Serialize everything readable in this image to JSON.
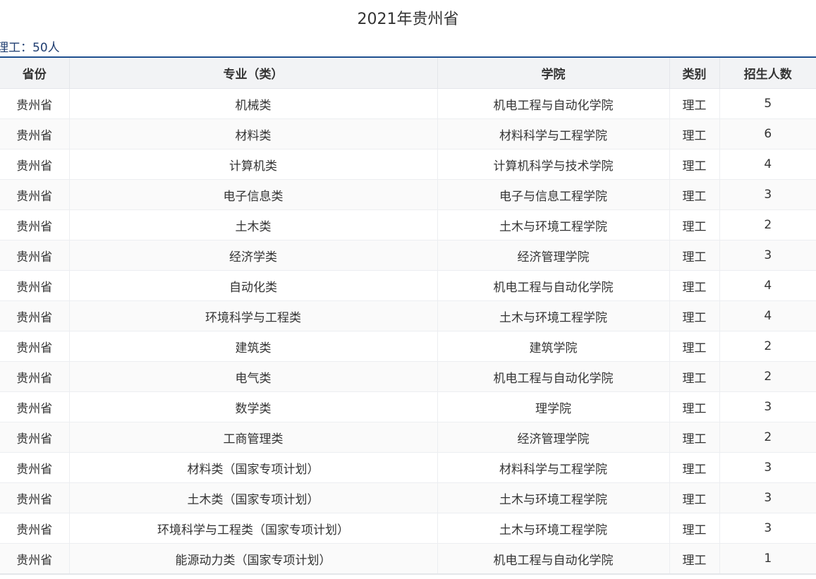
{
  "title": "2021年贵州省",
  "summary": {
    "label": "理工：",
    "value": "50人"
  },
  "table": {
    "headers": [
      "省份",
      "专业（类）",
      "学院",
      "类别",
      "招生人数"
    ],
    "rows": [
      [
        "贵州省",
        "机械类",
        "机电工程与自动化学院",
        "理工",
        "5"
      ],
      [
        "贵州省",
        "材料类",
        "材料科学与工程学院",
        "理工",
        "6"
      ],
      [
        "贵州省",
        "计算机类",
        "计算机科学与技术学院",
        "理工",
        "4"
      ],
      [
        "贵州省",
        "电子信息类",
        "电子与信息工程学院",
        "理工",
        "3"
      ],
      [
        "贵州省",
        "土木类",
        "土木与环境工程学院",
        "理工",
        "2"
      ],
      [
        "贵州省",
        "经济学类",
        "经济管理学院",
        "理工",
        "3"
      ],
      [
        "贵州省",
        "自动化类",
        "机电工程与自动化学院",
        "理工",
        "4"
      ],
      [
        "贵州省",
        "环境科学与工程类",
        "土木与环境工程学院",
        "理工",
        "4"
      ],
      [
        "贵州省",
        "建筑类",
        "建筑学院",
        "理工",
        "2"
      ],
      [
        "贵州省",
        "电气类",
        "机电工程与自动化学院",
        "理工",
        "2"
      ],
      [
        "贵州省",
        "数学类",
        "理学院",
        "理工",
        "3"
      ],
      [
        "贵州省",
        "工商管理类",
        "经济管理学院",
        "理工",
        "2"
      ],
      [
        "贵州省",
        "材料类（国家专项计划）",
        "材料科学与工程学院",
        "理工",
        "3"
      ],
      [
        "贵州省",
        "土木类（国家专项计划）",
        "土木与环境工程学院",
        "理工",
        "3"
      ],
      [
        "贵州省",
        "环境科学与工程类（国家专项计划）",
        "土木与环境工程学院",
        "理工",
        "3"
      ],
      [
        "贵州省",
        "能源动力类（国家专项计划）",
        "机电工程与自动化学院",
        "理工",
        "1"
      ]
    ]
  }
}
